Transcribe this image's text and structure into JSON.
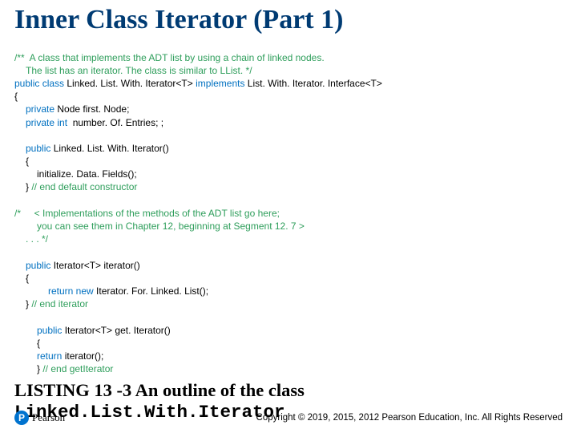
{
  "title": "Inner Class Iterator (Part 1)",
  "code": {
    "c1a": "/**  A class that implements the ADT list by using a chain of linked nodes.",
    "c1b": "The list has an iterator. The class is similar to LList. */",
    "l1_a": "public class",
    "l1_b": " Linked. List. With. Iterator<T> ",
    "l1_c": "implements",
    "l1_d": " List. With. Iterator. Interface<T>",
    "l2": "{",
    "l3_a": "private",
    "l3_b": " Node first. Node;",
    "l4_a": "private int",
    "l4_b": "  number. Of. Entries; ;",
    "l6_a": "public",
    "l6_b": " Linked. List. With. Iterator()",
    "l7": "{",
    "l8": "initialize. Data. Fields();",
    "l9_a": "} ",
    "l9_b": "// end default constructor",
    "c2a": "/*     < Implementations of the methods of the ADT list go here;",
    "c2b": "you can see them in Chapter 12, beginning at Segment 12. 7 >",
    "c2c": ". . . */",
    "l11_a": "public",
    "l11_b": " Iterator<T> iterator()",
    "l12": "{",
    "l13_a": "return new",
    "l13_b": " Iterator. For. Linked. List();",
    "l14_a": "} ",
    "l14_b": "// end iterator",
    "l16_a": "public",
    "l16_b": " Iterator<T> get. Iterator()",
    "l17": "{",
    "l18_a": "return",
    "l18_b": " iterator();",
    "l19_a": "} ",
    "l19_b": "// end getIterator"
  },
  "caption_lead": "LISTING 13 -3 An outline of the class ",
  "caption_class": "Linked.List.With.Iterator",
  "logo_letter": "P",
  "logo_text": "Pearson",
  "copyright": "Copyright © 2019, 2015, 2012 Pearson Education, Inc. All Rights Reserved"
}
